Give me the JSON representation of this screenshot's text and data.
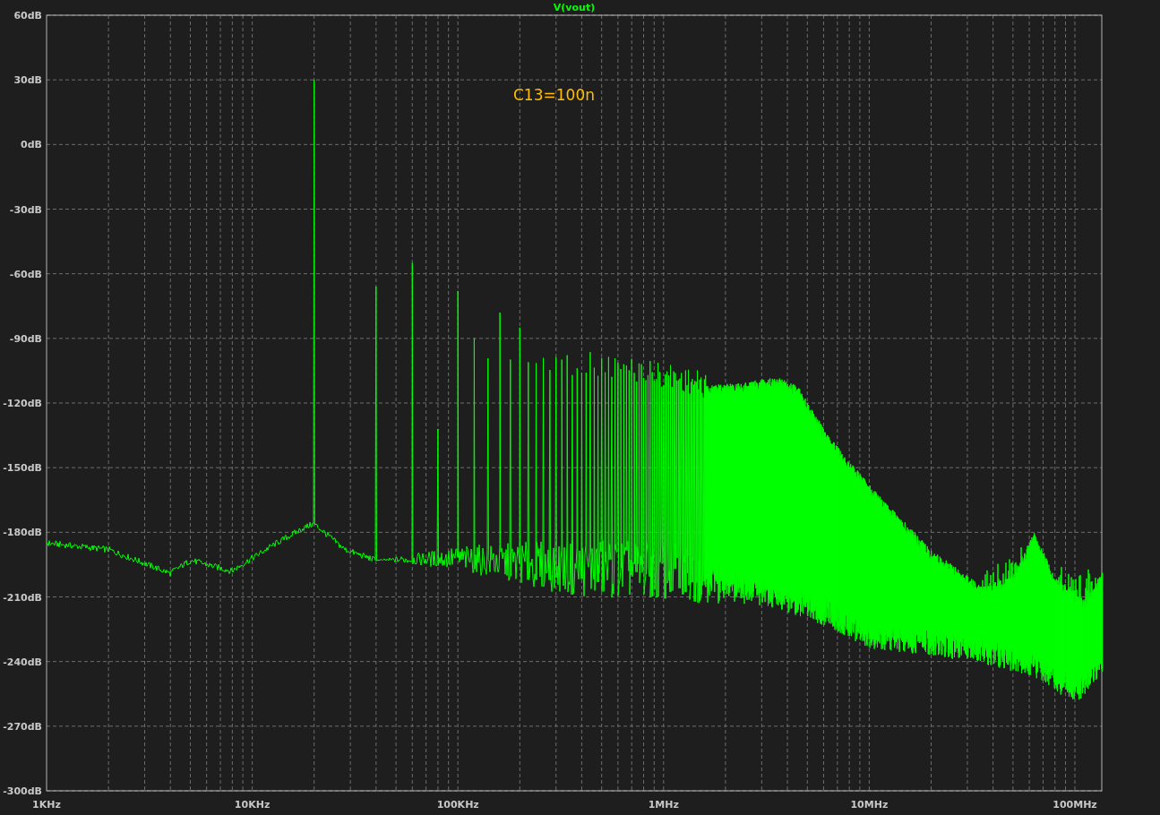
{
  "plot": {
    "title": "V(vout)",
    "annotation": "C13=100n",
    "y_labels": [
      "60dB",
      "30dB",
      "0dB",
      "-30dB",
      "-60dB",
      "-90dB",
      "-120dB",
      "-150dB",
      "-180dB",
      "-210dB",
      "-240dB",
      "-270dB",
      "-300dB"
    ],
    "x_labels": [
      "1KHz",
      "10KHz",
      "100KHz",
      "1MHz",
      "10MHz",
      "100MHz"
    ]
  }
}
